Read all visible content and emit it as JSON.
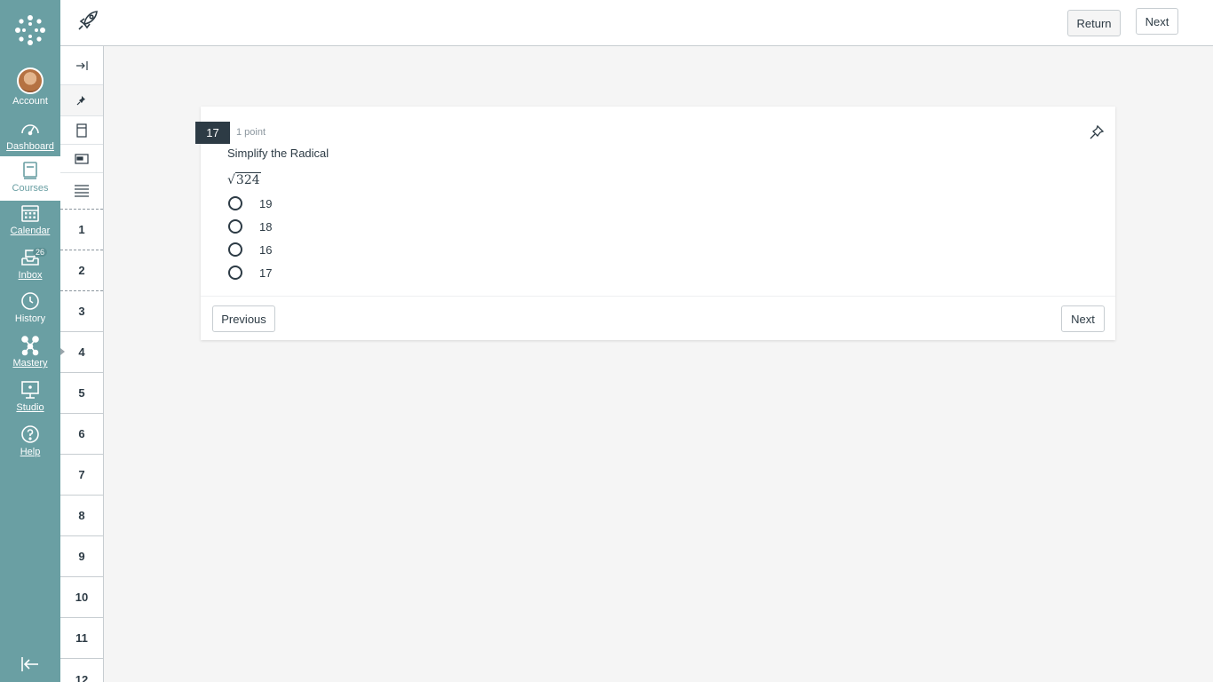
{
  "global_nav": {
    "items": [
      {
        "label": "Account",
        "icon": "avatar"
      },
      {
        "label": "Dashboard",
        "icon": "dashboard-icon"
      },
      {
        "label": "Courses",
        "icon": "courses-icon"
      },
      {
        "label": "Calendar",
        "icon": "calendar-icon"
      },
      {
        "label": "Inbox",
        "icon": "inbox-icon",
        "badge": "26"
      },
      {
        "label": "History",
        "icon": "history-icon"
      },
      {
        "label": "Mastery",
        "icon": "mastery-icon"
      },
      {
        "label": "Studio",
        "icon": "studio-icon"
      },
      {
        "label": "Help",
        "icon": "help-icon"
      }
    ]
  },
  "top_bar": {
    "return_label": "Return",
    "next_label": "Next"
  },
  "question_nav": {
    "numbers": [
      "1",
      "2",
      "3",
      "4",
      "5",
      "6",
      "7",
      "8",
      "9",
      "10",
      "11",
      "12"
    ]
  },
  "question": {
    "number": "17",
    "points": "1 point",
    "text": "Simplify the Radical",
    "math": "324",
    "options": [
      "19",
      "18",
      "16",
      "17"
    ]
  },
  "footer": {
    "previous_label": "Previous",
    "next_label": "Next"
  },
  "colors": {
    "nav_bg": "#6a9fa3",
    "text": "#2d3b45",
    "muted": "#8b969e"
  }
}
